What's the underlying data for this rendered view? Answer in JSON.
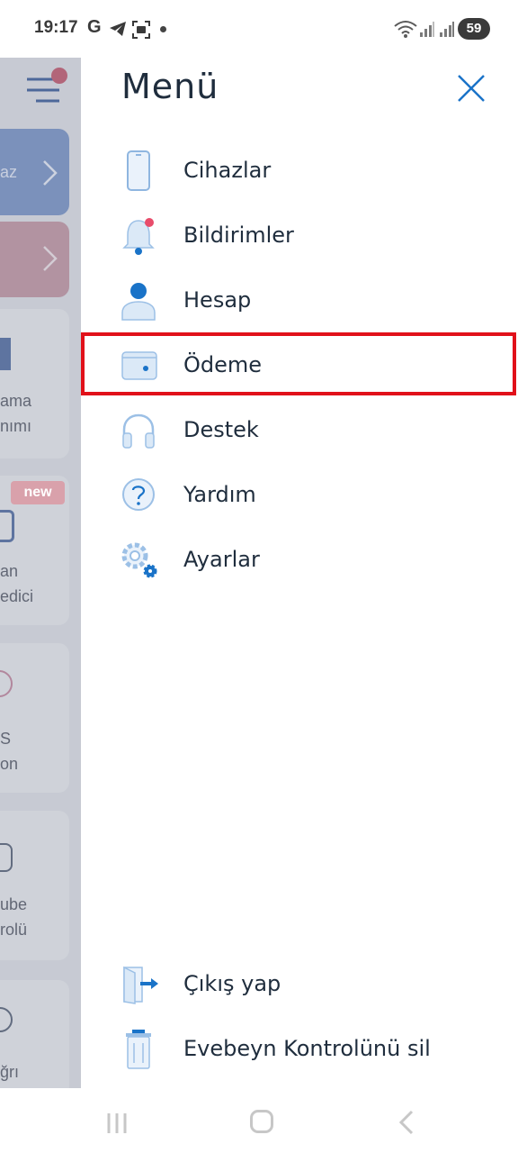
{
  "status_bar": {
    "time": "19:17",
    "g_label": "G",
    "battery": "59"
  },
  "background": {
    "cards": [
      {
        "text": "az"
      },
      {
        "text": ""
      },
      {
        "text": "ama\nnımı"
      },
      {
        "text": "an\nedici"
      },
      {
        "text": "S\non"
      },
      {
        "text": "ube\nrolü"
      },
      {
        "text": "ğrı"
      }
    ],
    "new_badge": "new",
    "colors": {
      "blue_card": "#7d97c9",
      "pink_card": "#c99aa6",
      "badge": "#d9a1ab"
    }
  },
  "drawer": {
    "title": "Menü",
    "items": [
      {
        "label": "Cihazlar",
        "icon": "phone-icon"
      },
      {
        "label": "Bildirimler",
        "icon": "bell-icon"
      },
      {
        "label": "Hesap",
        "icon": "user-icon"
      },
      {
        "label": "Ödeme",
        "icon": "wallet-icon"
      },
      {
        "label": "Destek",
        "icon": "headphones-icon"
      },
      {
        "label": "Yardım",
        "icon": "help-icon"
      },
      {
        "label": "Ayarlar",
        "icon": "settings-icon"
      }
    ],
    "footer_items": [
      {
        "label": "Çıkış yap",
        "icon": "logout-icon"
      },
      {
        "label": "Evebeyn Kontrolünü sil",
        "icon": "trash-icon"
      }
    ],
    "colors": {
      "accent": "#1a73c8",
      "icon_light": "#dbe9f7",
      "badge_red": "#e84c6b",
      "highlight": "#e1111a"
    }
  }
}
